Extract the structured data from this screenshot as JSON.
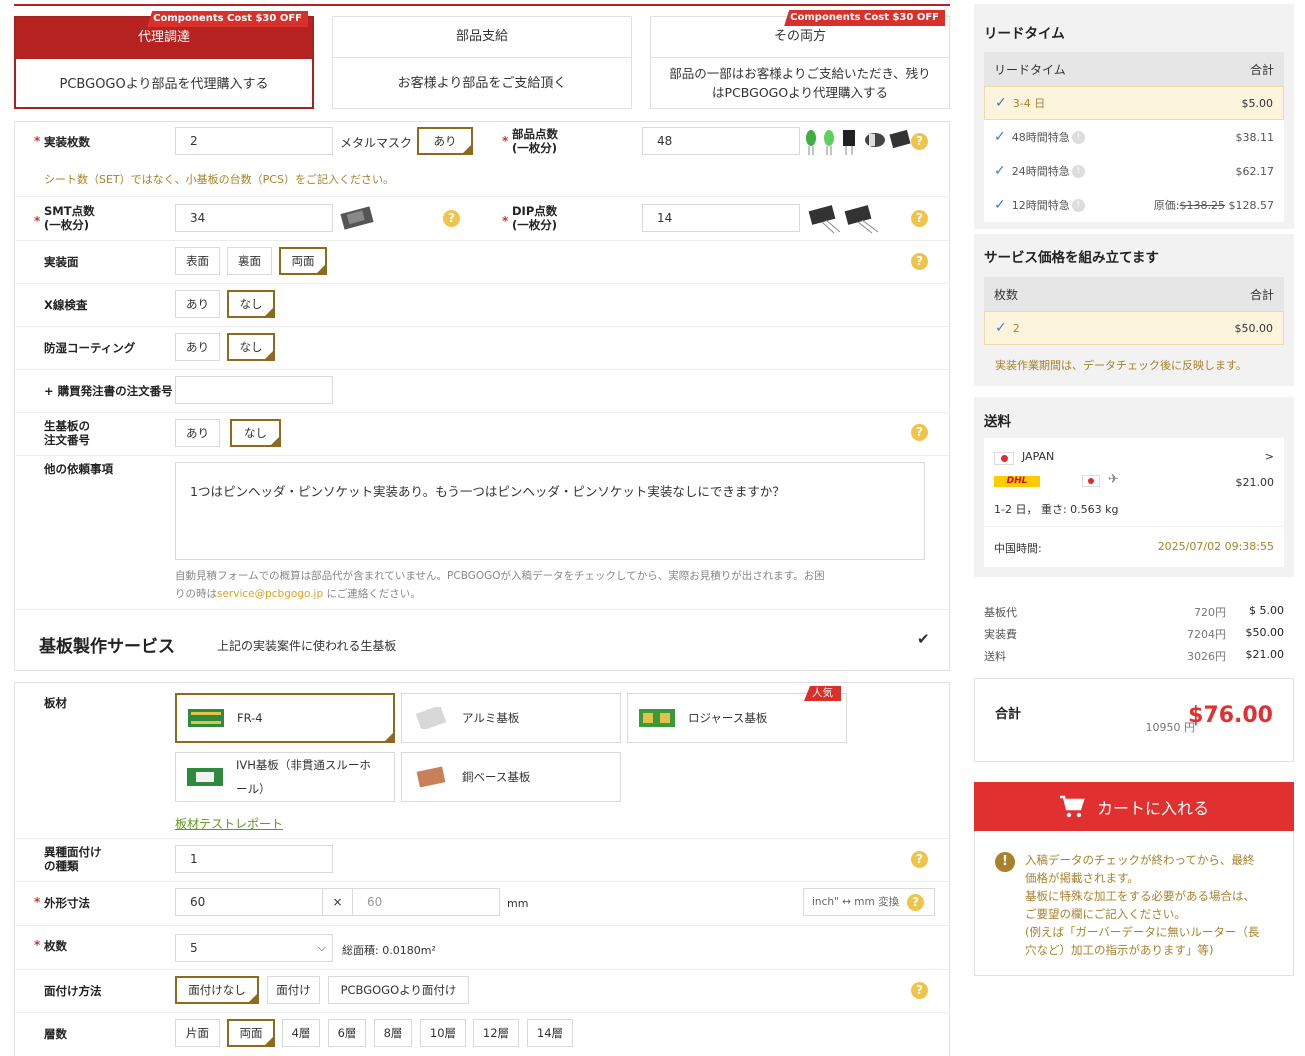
{
  "source": {
    "options": [
      {
        "title": "代理調達",
        "desc": "PCBGOGOより部品を代理購入する",
        "tag": "Components Cost $30 OFF"
      },
      {
        "title": "部品支給",
        "desc": "お客様より部品をご支給頂く"
      },
      {
        "title": "その両方",
        "desc": "部品の一部はお客様よりご支給いただき、残りはPCBGOGOより代理購入する",
        "tag": "Components Cost $30 OFF"
      }
    ]
  },
  "assembly": {
    "qty_label": "実装枚数",
    "qty_value": "2",
    "mask_label": "メタルマスク",
    "mask_value": "あり",
    "parts_label": "部品点数\n(一枚分)",
    "parts_value": "48",
    "qty_note": "シート数（SET）ではなく、小基板の台数（PCS）をご記入ください。",
    "smt_label": "SMT点数\n(一枚分)",
    "smt_value": "34",
    "dip_label": "DIP点数\n(一枚分)",
    "dip_value": "14",
    "side_label": "実装面",
    "side_options": [
      "表面",
      "裏面",
      "両面"
    ],
    "xray_label": "X線検査",
    "xray_options": [
      "あり",
      "なし"
    ],
    "coat_label": "防湿コーティング",
    "coat_options": [
      "あり",
      "なし"
    ],
    "po_label": "+ 購買発注書の注文番号",
    "bare_label": "生基板の\n注文番号",
    "bare_options": [
      "あり",
      "なし"
    ],
    "other_label": "他の依頼事項",
    "other_value": "1つはピンヘッダ・ピンソケット実装あり。もう一つはピンヘッダ・ピンソケット実装なしにできますか？",
    "other_note_1": "自動見積フォームでの概算は部品代が含まれていません。PCBGOGOが入稿データをチェックしてから、実際お見積りが出されます。お困",
    "other_note_2a": "りの時は",
    "other_note_email": "service@pcbgogo.jp",
    "other_note_2b": " にご連絡ください。"
  },
  "pcb": {
    "section_title": "基板製作サービス",
    "section_sub": "上記の実装案件に使われる生基板",
    "material_label": "板材",
    "materials": [
      "FR-4",
      "アルミ基板",
      "ロジャース基板",
      "IVH基板（非貫通スルーホール）",
      "銅ベース基板"
    ],
    "materials_line": [
      "IVH基板（非貫通スルーホ",
      "ール）"
    ],
    "popular_tag": "人気",
    "material_report": "板材テストレポート",
    "types_label": "異種面付け\nの種類",
    "types_value": "1",
    "dim_label": "外形寸法",
    "dim_x": "60",
    "dim_y": "60",
    "dim_times": "×",
    "dim_unit": "mm",
    "convert_label": "inch\" ↔ mm 変換",
    "count_label": "枚数",
    "count_value": "5",
    "area_text": "総面積: 0.0180m²",
    "panel_label": "面付け方法",
    "panel_options": [
      "面付けなし",
      "面付け",
      "PCBGOGOより面付け"
    ],
    "layers_label": "層数",
    "layers": [
      "片面",
      "両面",
      "4層",
      "6層",
      "8層",
      "10層",
      "12層",
      "14層"
    ]
  },
  "sidebar": {
    "lead_title": "リードタイム",
    "lead_head": [
      "リードタイム",
      "合計"
    ],
    "lead_rows": [
      {
        "name": "3-4 日",
        "price": "$5.00"
      },
      {
        "name": "48時間特急",
        "price": "$38.11"
      },
      {
        "name": "24時間特急",
        "price": "$62.17"
      },
      {
        "name": "12時間特急",
        "orig_label": "原価:",
        "orig": "$138.25",
        "price": "$128.57"
      }
    ],
    "svc_title": "サービス価格を組み立てます",
    "svc_head": [
      "枚数",
      "合計"
    ],
    "svc_row": {
      "name": "2",
      "price": "$50.00"
    },
    "svc_note": "実装作業期間は、データチェック後に反映します。",
    "ship_title": "送料",
    "ship_country": "JAPAN",
    "ship_arrow": ">",
    "ship_carrier": "DHL",
    "ship_price": "$21.00",
    "ship_days": "1-2 日， 重さ: 0.563 kg",
    "china_time_label": "中国時間:",
    "china_time": "2025/07/02 09:38:55",
    "costs": [
      {
        "name": "基板代",
        "yen": "720円",
        "usd": "$ 5.00"
      },
      {
        "name": "実装費",
        "yen": "7204円",
        "usd": "$50.00"
      },
      {
        "name": "送料",
        "yen": "3026円",
        "usd": "$21.00"
      }
    ],
    "total_label": "合計",
    "total_yen": "10950 円",
    "total_usd": "$76.00",
    "cart_label": "カートに入れる",
    "notice": [
      "入稿データのチェックが終わってから、最終",
      "価格が掲載されます。",
      "基板に特殊な加工をする必要がある場合は、",
      "ご要望の欄にご記入ください。",
      "(例えば「ガーバーデータに無いルーター（長",
      "穴など）加工の指示があります」等)"
    ]
  },
  "colors": {
    "accent": "#b5221f",
    "cart": "#e03030",
    "gold": "#8d6a1e",
    "help": "#f0c44a",
    "note": "#a8822a"
  }
}
